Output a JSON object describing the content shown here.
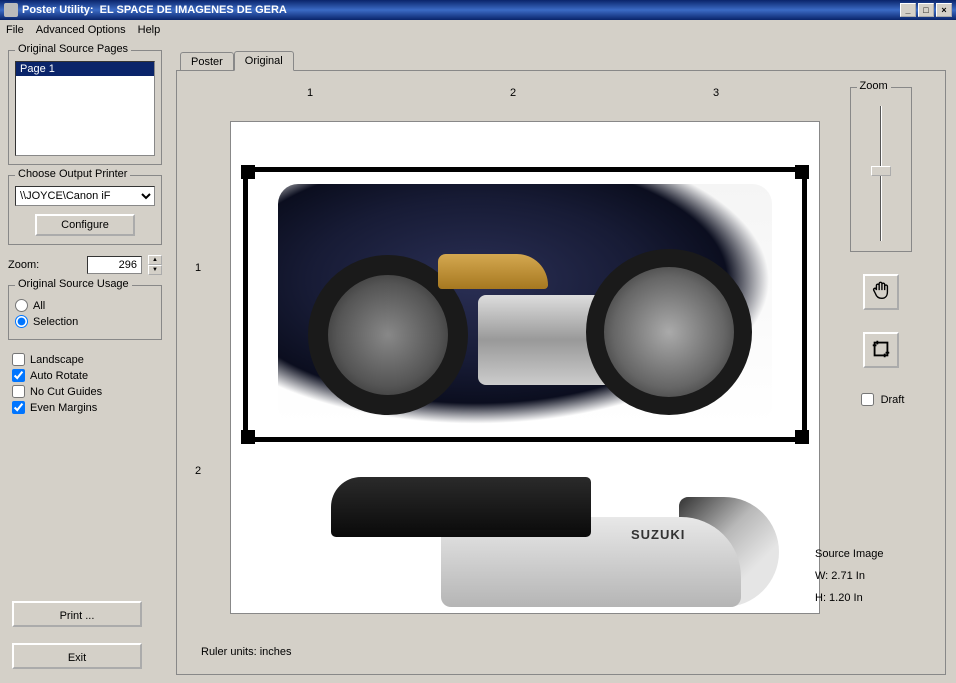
{
  "titlebar": {
    "app_name": "Poster Utility:",
    "document": "EL SPACE DE IMAGENES DE GERA"
  },
  "menu": {
    "file": "File",
    "advanced": "Advanced Options",
    "help": "Help"
  },
  "left": {
    "source_pages_title": "Original Source Pages",
    "page_item": "Page 1",
    "printer_title": "Choose Output Printer",
    "printer_value": "\\\\JOYCE\\Canon iF",
    "configure": "Configure",
    "zoom_label": "Zoom:",
    "zoom_value": "296",
    "usage_title": "Original Source Usage",
    "usage_all": "All",
    "usage_selection": "Selection",
    "landscape": "Landscape",
    "auto_rotate": "Auto Rotate",
    "no_cut_guides": "No Cut Guides",
    "even_margins": "Even Margins",
    "print": "Print ...",
    "exit": "Exit"
  },
  "tabs": {
    "poster": "Poster",
    "original": "Original"
  },
  "ruler": {
    "m1": "1",
    "m2": "2",
    "m3": "3",
    "v1": "1",
    "v2": "2",
    "units_label": "Ruler units:  inches"
  },
  "moto2_brand": "SUZUKI",
  "tools": {
    "zoom_title": "Zoom",
    "draft": "Draft"
  },
  "source": {
    "title": "Source Image",
    "width": "W: 2.71 In",
    "height": "H: 1.20 In"
  }
}
